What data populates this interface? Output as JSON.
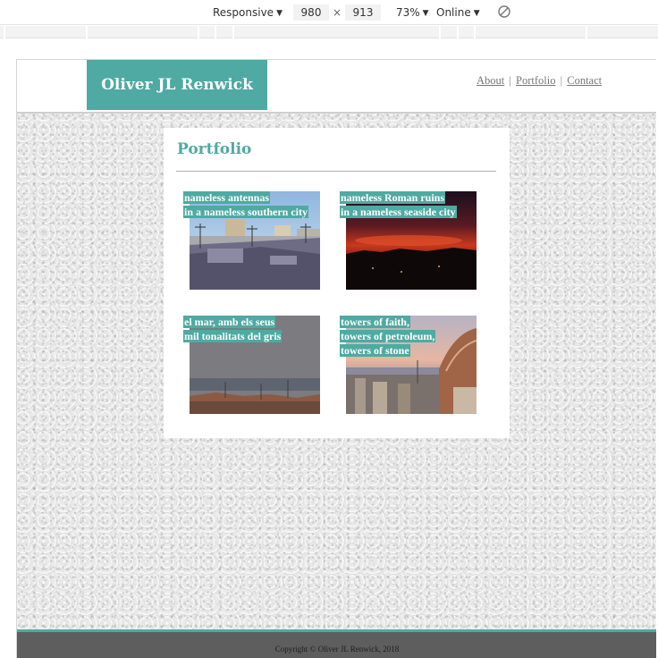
{
  "devtools": {
    "device": "Responsive",
    "width": "980",
    "times": "×",
    "height": "913",
    "zoom": "73%",
    "network": "Online",
    "dropdown_arrow": "▼",
    "rotate_icon": "rotate-icon"
  },
  "site": {
    "logo": "Oliver JL Renwick",
    "nav": {
      "about": "About",
      "portfolio": "Portfolio",
      "contact": "Contact",
      "separator": "|"
    },
    "page_title": "Portfolio",
    "tiles": [
      {
        "lines": [
          "nameless antennas",
          "in a nameless southern city"
        ],
        "photo": "rooftops-antennas"
      },
      {
        "lines": [
          "nameless Roman ruins",
          "in a nameless seaside city"
        ],
        "photo": "red-sunset-silhouette"
      },
      {
        "lines": [
          "el mar, amb els seus",
          "mil tonalitats del gris"
        ],
        "photo": "grey-sea-rooftops"
      },
      {
        "lines": [
          "towers of faith,",
          "towers of petroleum,",
          "towers of stone"
        ],
        "photo": "cathedral-dome-sunset"
      }
    ],
    "footer": "Copyright © Oliver JL Renwick, 2018"
  },
  "colors": {
    "accent": "#4eaaa2",
    "footer": "#5e5e5e",
    "page_bg": "#eaeaea"
  }
}
